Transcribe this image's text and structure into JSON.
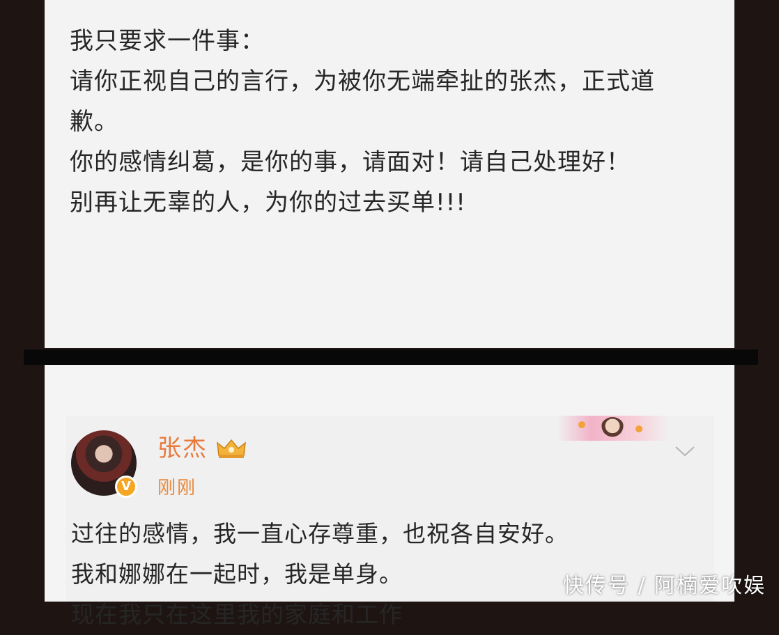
{
  "top_post": {
    "lines": [
      "我只要求一件事：",
      "请你正视自己的言行，为被你无端牵扯的张杰，正式道",
      "歉。",
      "你的感情纠葛，是你的事，请面对！请自己处理好！",
      "别再让无辜的人，为你的过去买单!!!"
    ]
  },
  "bottom_post": {
    "username": "张杰",
    "timestamp": "刚刚",
    "verified_icon": "V",
    "lines": [
      "过往的感情，我一直心存尊重，也祝各自安好。",
      "我和娜娜在一起时，我是单身。",
      "现在我只在这里我的家庭和工作"
    ]
  },
  "watermark": "快传号 / 阿楠爱吹娱",
  "colors": {
    "username": "#e8793c",
    "timestamp": "#e8893c",
    "verified_badge": "#f5a623",
    "text": "#262626"
  },
  "icons": [
    "crown-icon",
    "chevron-down-icon",
    "verified-icon"
  ]
}
